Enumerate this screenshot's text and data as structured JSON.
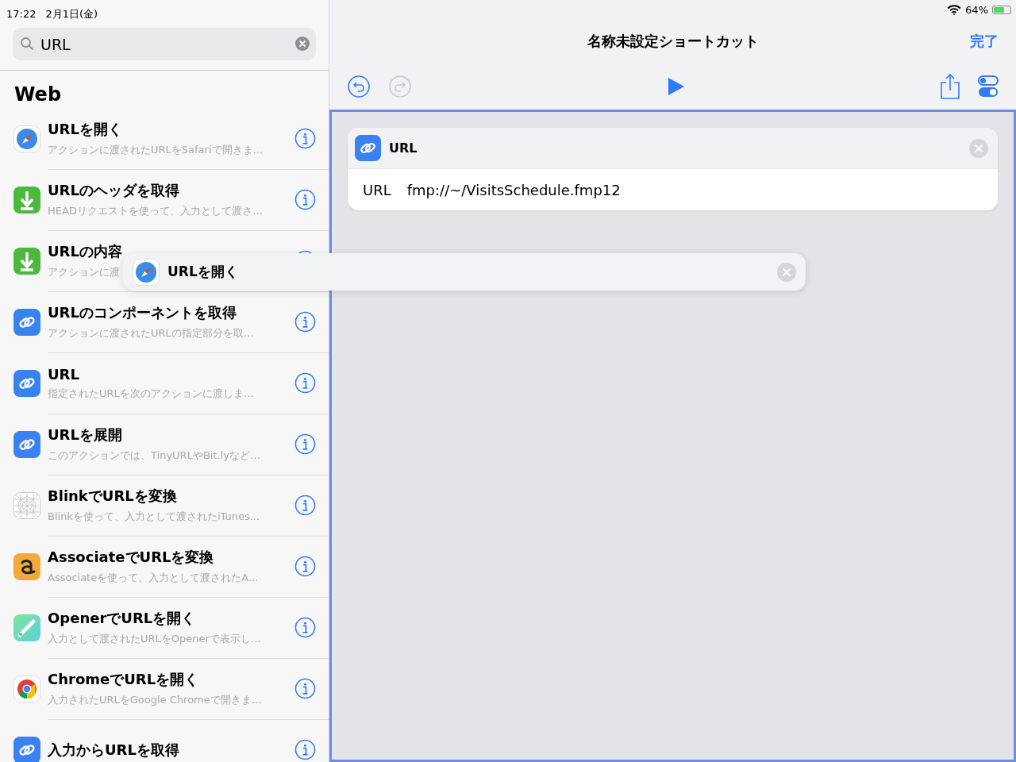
{
  "status_bar": {
    "time": "17:22",
    "date": "2月1日(金)",
    "battery": "64%"
  },
  "search": {
    "value": "URL"
  },
  "section": "Web",
  "actions": [
    {
      "kind": "safari",
      "title": "URLを開く",
      "subtitle": "アクションに渡されたURLをSafariで開きま…"
    },
    {
      "kind": "download",
      "title": "URLのヘッダを取得",
      "subtitle": "HEADリクエストを使って、入力として渡さ…"
    },
    {
      "kind": "download",
      "title": "URLの内容",
      "subtitle": "アクションに渡"
    },
    {
      "kind": "link",
      "title": "URLのコンポーネントを取得",
      "subtitle": "アクションに渡されたURLの指定部分を取…"
    },
    {
      "kind": "link",
      "title": "URL",
      "subtitle": "指定されたURLを次のアクションに渡しま…"
    },
    {
      "kind": "link",
      "title": "URLを展開",
      "subtitle": "このアクションでは、TinyURLやBit.lyなど…"
    },
    {
      "kind": "blink",
      "title": "BlinkでURLを変換",
      "subtitle": "Blinkを使って、入力として渡されたiTunes..."
    },
    {
      "kind": "associate",
      "title": "AssociateでURLを変換",
      "subtitle": "Associateを使って、入力として渡されたA..."
    },
    {
      "kind": "opener",
      "title": "OpenerでURLを開く",
      "subtitle": "入力として渡されたURLをOpenerで表示し…"
    },
    {
      "kind": "chrome",
      "title": "ChromeでURLを開く",
      "subtitle": "入力されたURLをGoogle Chromeで開きま…"
    },
    {
      "kind": "link",
      "title": "入力からURLを取得"
    }
  ],
  "editor": {
    "title": "名称未設定ショートカット",
    "done": "完了",
    "undo_enabled": true,
    "redo_enabled": false
  },
  "blocks": [
    {
      "kind": "link",
      "title": "URL",
      "param_label": "URL",
      "param_value": "fmp://~/VisitsSchedule.fmp12"
    }
  ],
  "dragged": {
    "kind": "safari",
    "title": "URLを開く"
  }
}
